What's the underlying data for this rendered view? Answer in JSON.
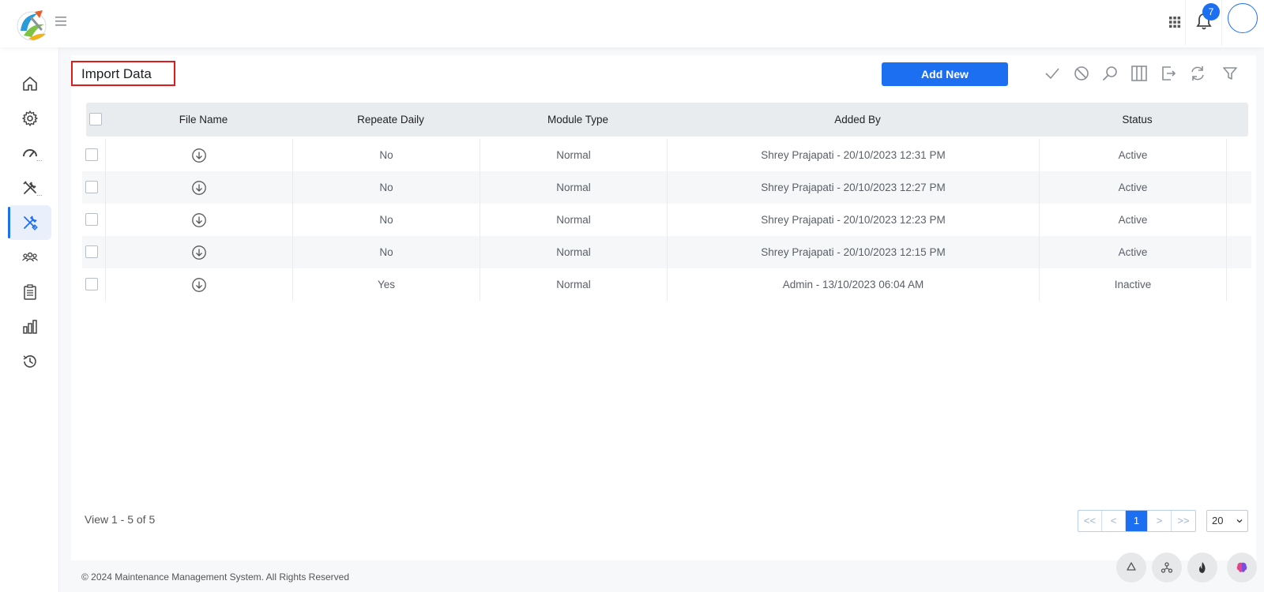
{
  "header": {
    "notification_count": "7",
    "icons": [
      "app-logo",
      "hamburger-menu-icon",
      "apps-grid-icon",
      "bell-icon",
      "user-avatar"
    ]
  },
  "sidebar": {
    "items": [
      {
        "icon": "home-icon"
      },
      {
        "icon": "gear-icon"
      },
      {
        "icon": "gauge-icon",
        "more": "..."
      },
      {
        "icon": "tools-icon",
        "more": "..."
      },
      {
        "icon": "wrench-screwdriver-icon",
        "active": true
      },
      {
        "icon": "users-group-icon"
      },
      {
        "icon": "clipboard-icon"
      },
      {
        "icon": "bar-chart-icon"
      },
      {
        "icon": "history-icon"
      }
    ]
  },
  "page": {
    "title": "Import Data",
    "add_button": "Add New",
    "toolbar_icons": [
      "check-icon",
      "block-icon",
      "search-icon",
      "columns-icon",
      "export-icon",
      "refresh-icon",
      "filter-icon"
    ]
  },
  "table": {
    "columns": [
      "File Name",
      "Repeate Daily",
      "Module Type",
      "Added By",
      "Status"
    ],
    "rows": [
      {
        "repeat": "No",
        "module": "Normal",
        "added_by": "Shrey Prajapati - 20/10/2023 12:31 PM",
        "status": "Active"
      },
      {
        "repeat": "No",
        "module": "Normal",
        "added_by": "Shrey Prajapati - 20/10/2023 12:27 PM",
        "status": "Active"
      },
      {
        "repeat": "No",
        "module": "Normal",
        "added_by": "Shrey Prajapati - 20/10/2023 12:23 PM",
        "status": "Active"
      },
      {
        "repeat": "No",
        "module": "Normal",
        "added_by": "Shrey Prajapati - 20/10/2023 12:15 PM",
        "status": "Active"
      },
      {
        "repeat": "Yes",
        "module": "Normal",
        "added_by": "Admin - 13/10/2023 06:04 AM",
        "status": "Inactive"
      }
    ]
  },
  "pagination": {
    "view_text": "View 1 - 5 of 5",
    "first": "<<",
    "prev": "<",
    "current": "1",
    "next": ">",
    "last": ">>",
    "per_page": "20"
  },
  "footer": {
    "copyright": "© 2024 Maintenance Management System. All Rights Reserved",
    "fab_icons": [
      "recycle-icon",
      "hub-icon",
      "fire-icon",
      "brain-icon"
    ]
  },
  "colors": {
    "accent": "#1d6ff2",
    "title_highlight_border": "#e01b1b",
    "header_row_bg": "#e9ecef"
  }
}
